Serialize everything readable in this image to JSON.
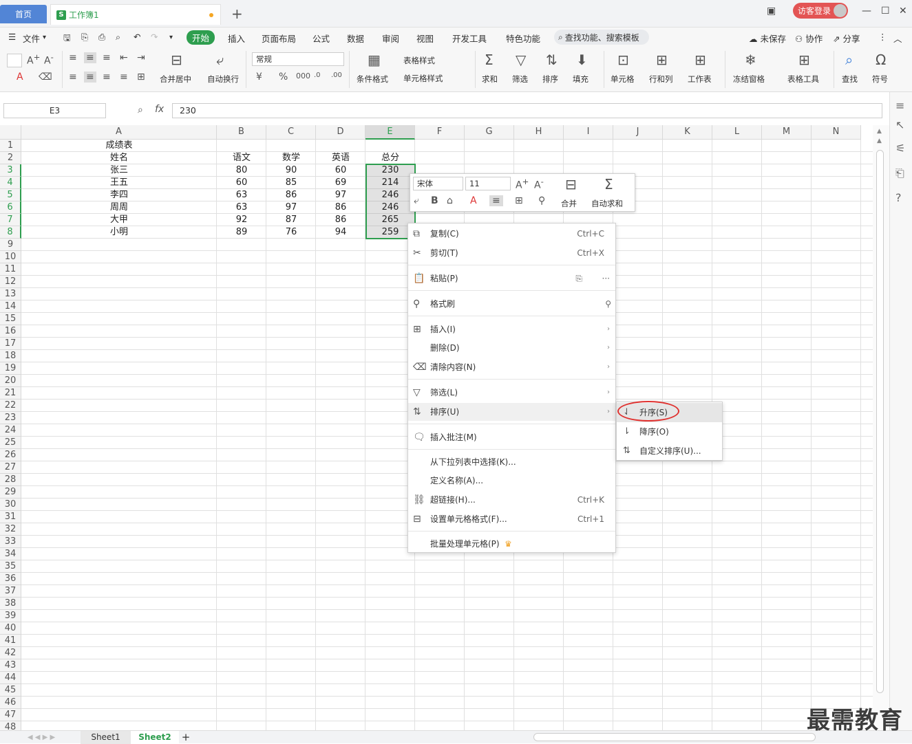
{
  "tabs": {
    "home": "首页",
    "doc": "工作簿1",
    "new": "+"
  },
  "window": {
    "login": "访客登录"
  },
  "menu": {
    "file": "文件",
    "items": [
      "开始",
      "插入",
      "页面布局",
      "公式",
      "数据",
      "审阅",
      "视图",
      "开发工具",
      "特色功能"
    ],
    "search": "查找功能、搜索模板",
    "unsaved": "未保存",
    "collab": "协作",
    "share": "分享"
  },
  "ribbon": {
    "merge_center": "合并居中",
    "wrap": "自动换行",
    "format_combo": "常规",
    "cond_format": "条件格式",
    "table_style": "表格样式",
    "cell_style": "单元格样式",
    "sum": "求和",
    "filter": "筛选",
    "sort": "排序",
    "fill": "填充",
    "cell": "单元格",
    "rowcol": "行和列",
    "sheet": "工作表",
    "freeze": "冻结窗格",
    "table_tools": "表格工具",
    "find": "查找",
    "symbol": "符号"
  },
  "formula": {
    "cell_ref": "E3",
    "fx": "fx",
    "value": "230"
  },
  "grid": {
    "columns": [
      "A",
      "B",
      "C",
      "D",
      "E",
      "F",
      "G",
      "H",
      "I",
      "J",
      "K",
      "L",
      "M",
      "N"
    ],
    "rows": [
      "1",
      "2",
      "3",
      "4",
      "5",
      "6",
      "7",
      "8",
      "9",
      "10",
      "11",
      "12",
      "13",
      "14",
      "15",
      "16",
      "17",
      "18",
      "19",
      "20",
      "21",
      "22",
      "23",
      "24",
      "25",
      "26",
      "27",
      "28",
      "29",
      "30",
      "31",
      "32",
      "33",
      "34",
      "35",
      "36",
      "37",
      "38",
      "39",
      "40",
      "41",
      "42",
      "43",
      "44",
      "45",
      "46",
      "47",
      "48"
    ],
    "title": "成绩表",
    "headers": [
      "姓名",
      "语文",
      "数学",
      "英语",
      "总分"
    ],
    "data": [
      [
        "张三",
        "80",
        "90",
        "60",
        "230"
      ],
      [
        "王五",
        "60",
        "85",
        "69",
        "214"
      ],
      [
        "李四",
        "63",
        "86",
        "97",
        "246"
      ],
      [
        "周周",
        "63",
        "97",
        "86",
        "246"
      ],
      [
        "大甲",
        "92",
        "87",
        "86",
        "265"
      ],
      [
        "小明",
        "89",
        "76",
        "94",
        "259"
      ]
    ]
  },
  "mini_toolbar": {
    "font": "宋体",
    "size": "11",
    "merge": "合并",
    "autosum": "自动求和"
  },
  "context_menu": {
    "copy": "复制(C)",
    "copy_sc": "Ctrl+C",
    "cut": "剪切(T)",
    "cut_sc": "Ctrl+X",
    "paste": "粘贴(P)",
    "format_painter": "格式刷",
    "insert": "插入(I)",
    "delete": "删除(D)",
    "clear": "清除内容(N)",
    "filter": "筛选(L)",
    "sort": "排序(U)",
    "comment": "插入批注(M)",
    "dropdown_pick": "从下拉列表中选择(K)...",
    "define_name": "定义名称(A)...",
    "hyperlink": "超链接(H)...",
    "hyperlink_sc": "Ctrl+K",
    "cell_format": "设置单元格格式(F)...",
    "cell_format_sc": "Ctrl+1",
    "batch": "批量处理单元格(P)"
  },
  "sort_submenu": {
    "asc": "升序(S)",
    "desc": "降序(O)",
    "custom": "自定义排序(U)..."
  },
  "sheets": [
    "Sheet1",
    "Sheet2"
  ],
  "watermark": "最需教育",
  "colors": {
    "accent": "#2e9e4f",
    "home_tab": "#5285d6",
    "login": "#e35454",
    "highlight": "#e0312f"
  }
}
